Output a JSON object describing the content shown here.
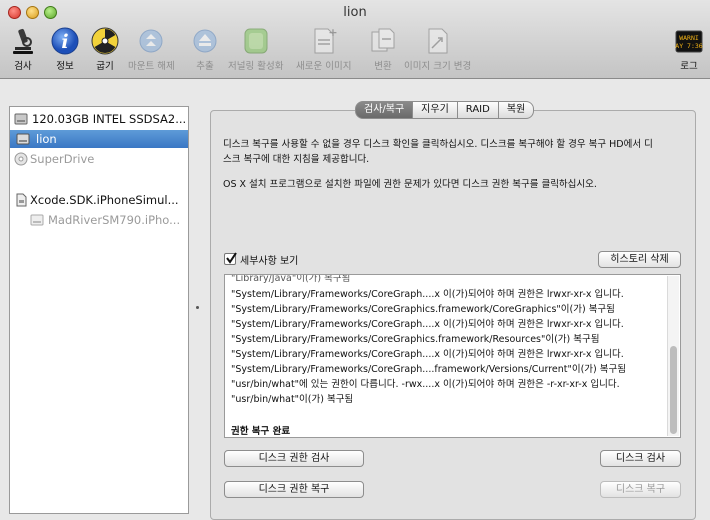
{
  "window": {
    "title": "lion"
  },
  "toolbar": {
    "items": [
      {
        "label": "검사",
        "icon": "microscope-icon",
        "enabled": true
      },
      {
        "label": "정보",
        "icon": "info-icon",
        "enabled": true
      },
      {
        "label": "굽기",
        "icon": "burn-icon",
        "enabled": true
      },
      {
        "label": "마운트 해제",
        "icon": "unmount-icon",
        "enabled": false
      },
      {
        "label": "추출",
        "icon": "eject-icon",
        "enabled": false
      },
      {
        "label": "저널링 활성화",
        "icon": "journal-icon",
        "enabled": false
      },
      {
        "label": "새로운 이미지",
        "icon": "new-image-icon",
        "enabled": false
      },
      {
        "label": "변환",
        "icon": "convert-icon",
        "enabled": false
      },
      {
        "label": "이미지 크기 변경",
        "icon": "resize-image-icon",
        "enabled": false
      },
      {
        "label": "로그",
        "icon": "log-icon",
        "enabled": true,
        "icon_text": [
          "WARNI",
          "AY 7:36"
        ]
      }
    ]
  },
  "sidebar": {
    "items": [
      {
        "label": "120.03GB INTEL SSDSA2...",
        "icon": "hard-disk-icon",
        "selected": false,
        "dim": false
      },
      {
        "label": "lion",
        "icon": "volume-icon",
        "selected": true,
        "dim": false
      },
      {
        "label": "SuperDrive",
        "icon": "optical-drive-icon",
        "selected": false,
        "dim": true
      },
      {
        "label": "Xcode.SDK.iPhoneSimul...",
        "icon": "disk-image-icon",
        "selected": false,
        "dim": false
      },
      {
        "label": "MadRiverSM790.iPho...",
        "icon": "volume-icon",
        "selected": false,
        "dim": true
      }
    ]
  },
  "tabs": [
    {
      "label": "검사/복구",
      "active": true
    },
    {
      "label": "지우기",
      "active": false
    },
    {
      "label": "RAID",
      "active": false
    },
    {
      "label": "복원",
      "active": false
    }
  ],
  "first_aid": {
    "paragraph1": [
      "디스크 복구를 사용할 수 없을 경우 디스크 확인을 클릭하십시오. 디스크를 복구해야 할 경우 복구 HD에서 디",
      "스크 복구에 대한 지침을 제공합니다."
    ],
    "paragraph2": "OS X 설치 프로그램으로 설치한 파일에 권한 문제가 있다면 디스크 권한 복구를 클릭하십시오.",
    "show_details_label": "세부사항 보기",
    "show_details_checked": true,
    "clear_history_label": "히스토리 삭제",
    "log_lines": [
      "\"Library/Java\"이(가) 복구됨",
      "\"System/Library/Frameworks/CoreGraph....x 이(가)되어야 하며 권한은 lrwxr-xr-x 입니다.",
      "\"System/Library/Frameworks/CoreGraphics.framework/CoreGraphics\"이(가) 복구됨",
      "\"System/Library/Frameworks/CoreGraph....x 이(가)되어야 하며 권한은 lrwxr-xr-x 입니다.",
      "\"System/Library/Frameworks/CoreGraphics.framework/Resources\"이(가) 복구됨",
      "\"System/Library/Frameworks/CoreGraph....x 이(가)되어야 하며 권한은 lrwxr-xr-x 입니다.",
      "\"System/Library/Frameworks/CoreGraph....framework/Versions/Current\"이(가) 복구됨",
      "\"usr/bin/what\"에 있는 권한이 다릅니다. -rwx....x 이(가)되어야 하며 권한은 -r-xr-xr-x 입니다.",
      "\"usr/bin/what\"이(가) 복구됨",
      "",
      "권한 복구 완료"
    ],
    "buttons": {
      "verify_permissions": "디스크 권한 검사",
      "repair_permissions": "디스크 권한 복구",
      "verify_disk": "디스크 검사",
      "repair_disk": "디스크 복구"
    }
  }
}
